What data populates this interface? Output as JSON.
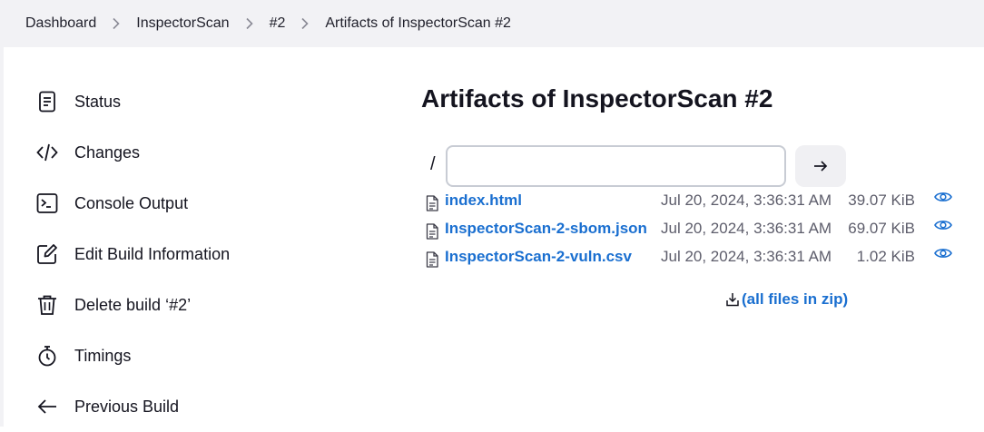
{
  "breadcrumb": {
    "items": [
      {
        "label": "Dashboard"
      },
      {
        "label": "InspectorScan"
      },
      {
        "label": "#2"
      },
      {
        "label": "Artifacts of InspectorScan #2"
      }
    ]
  },
  "sidebar": {
    "items": [
      {
        "label": "Status",
        "icon": "document-icon"
      },
      {
        "label": "Changes",
        "icon": "code-icon"
      },
      {
        "label": "Console Output",
        "icon": "terminal-icon"
      },
      {
        "label": "Edit Build Information",
        "icon": "edit-icon"
      },
      {
        "label": "Delete build ‘#2’",
        "icon": "trash-icon"
      },
      {
        "label": "Timings",
        "icon": "stopwatch-icon"
      },
      {
        "label": "Previous Build",
        "icon": "arrow-left-icon"
      }
    ]
  },
  "main": {
    "title": "Artifacts of InspectorScan #2",
    "path_prefix": "/",
    "path_input": {
      "value": "",
      "placeholder": ""
    },
    "files": [
      {
        "name": "index.html",
        "date": "Jul 20, 2024, 3:36:31 AM",
        "size": "39.07 KiB"
      },
      {
        "name": "InspectorScan-2-sbom.json",
        "date": "Jul 20, 2024, 3:36:31 AM",
        "size": "69.07 KiB"
      },
      {
        "name": "InspectorScan-2-vuln.csv",
        "date": "Jul 20, 2024, 3:36:31 AM",
        "size": "1.02 KiB"
      }
    ],
    "zip_label": "(all files in zip)"
  },
  "colors": {
    "link": "#1a6fd0",
    "breadcrumb_bg": "#f2f2f5",
    "muted_text": "#5d5d6b"
  }
}
